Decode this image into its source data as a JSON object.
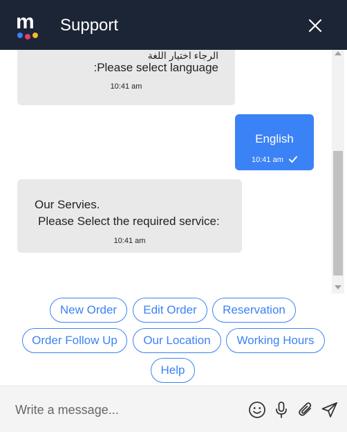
{
  "header": {
    "title": "Support",
    "logo_letter": "m"
  },
  "messages": [
    {
      "sender": "bot",
      "arabic": "الرجاء اختيار اللغة",
      "text": ":Please select language",
      "time": "10:41 am"
    },
    {
      "sender": "user",
      "text": "English",
      "time": "10:41 am"
    },
    {
      "sender": "bot",
      "line1": "Our Servies.",
      "line2": "Please Select the required service:",
      "time": "10:41 am"
    }
  ],
  "quick_replies": [
    "New Order",
    "Edit Order",
    "Reservation",
    "Order Follow Up",
    "Our Location",
    "Working Hours",
    "Help"
  ],
  "composer": {
    "placeholder": "Write a message..."
  },
  "colors": {
    "header_bg": "#1c2536",
    "accent": "#3b82f6",
    "bubble_bg": "#e9e9e9",
    "logo_dots": [
      "#3b82f6",
      "#e53e6b",
      "#f5b82e"
    ]
  },
  "icons": [
    "close-icon",
    "check-icon",
    "emoji-icon",
    "microphone-icon",
    "attachment-icon",
    "send-icon"
  ]
}
